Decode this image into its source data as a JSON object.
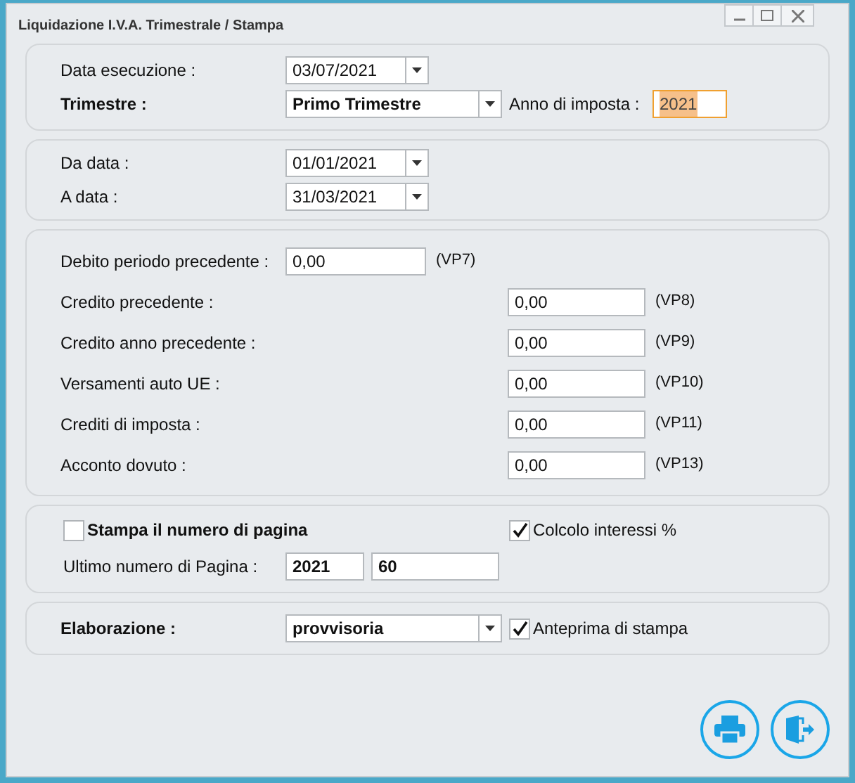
{
  "window": {
    "title": "Liquidazione I.V.A. Trimestrale / Stampa"
  },
  "period": {
    "execution_label": "Data esecuzione :",
    "execution_date": "03/07/2021",
    "quarter_label": "Trimestre :",
    "quarter": "Primo Trimestre",
    "year_label": "Anno di imposta :",
    "year": "2021",
    "year_focused": true
  },
  "range": [
    {
      "label": "Da data :",
      "value": "01/01/2021"
    },
    {
      "label": "A data :",
      "value": "31/03/2021"
    }
  ],
  "amounts": [
    {
      "label": "Debito periodo precedente :",
      "value": "0,00",
      "code": "(VP7)",
      "kind": "short"
    },
    {
      "label": "Credito precedente :",
      "value": "0,00",
      "code": "(VP8)",
      "kind": "wide"
    },
    {
      "label": "Credito anno precedente :",
      "value": "0,00",
      "code": "(VP9)",
      "kind": "wide"
    },
    {
      "label": "Versamenti auto UE :",
      "value": "0,00",
      "code": "(VP10)",
      "kind": "wide"
    },
    {
      "label": "Crediti di imposta :",
      "value": "0,00",
      "code": "(VP11)",
      "kind": "wide"
    },
    {
      "label": "Acconto dovuto :",
      "value": "0,00",
      "code": "(VP13)",
      "kind": "wide"
    }
  ],
  "pages": {
    "print_page_number": {
      "label": "Stampa il numero di pagina",
      "checked": false
    },
    "interest": {
      "label": "Colcolo interessi %",
      "checked": true
    },
    "last_page_label": "Ultimo numero di Pagina :",
    "last_page_year": "2021",
    "last_page_number": "60"
  },
  "processing": {
    "label": "Elaborazione :",
    "mode": "provvisoria",
    "preview": {
      "label": "Anteprima di stampa",
      "checked": true
    }
  }
}
